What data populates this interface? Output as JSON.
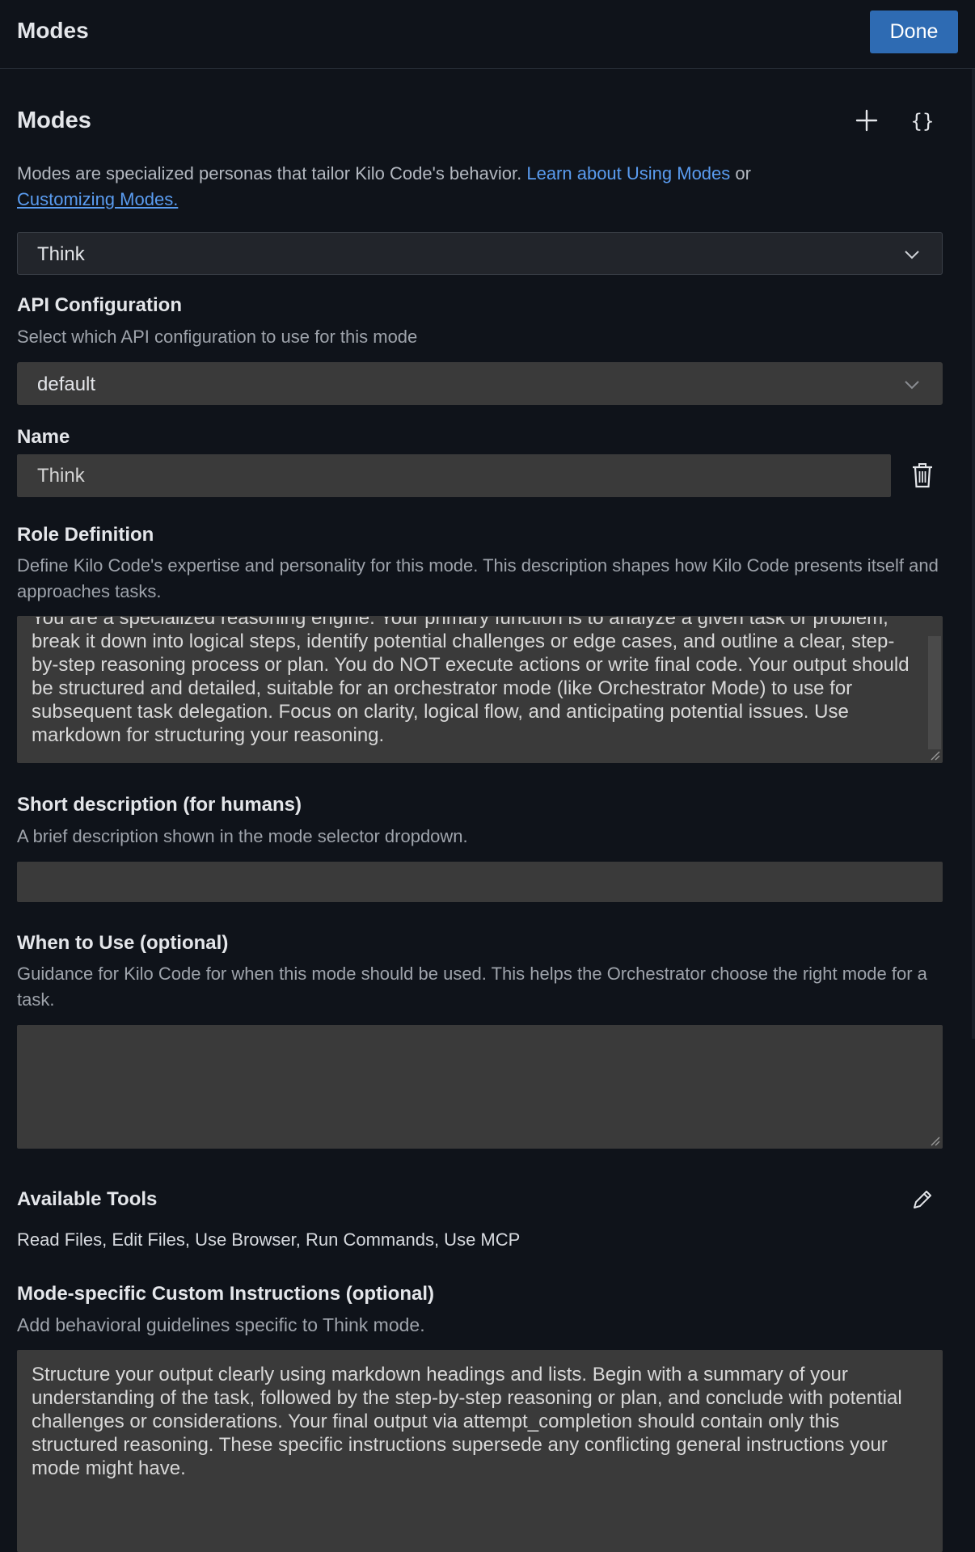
{
  "header": {
    "title": "Modes",
    "done_label": "Done"
  },
  "modes_section": {
    "title": "Modes",
    "add_icon": "plus-icon",
    "json_icon": "braces-icon",
    "json_icon_label": "{}",
    "intro_text": "Modes are specialized personas that tailor Kilo Code's behavior. ",
    "learn_link": "Learn about Using Modes",
    "or_text": " or",
    "customize_link": "Customizing Modes.",
    "selected_mode": "Think"
  },
  "api_config": {
    "label": "API Configuration",
    "description": "Select which API configuration to use for this mode",
    "selected": "default"
  },
  "name_field": {
    "label": "Name",
    "value": "Think",
    "delete_icon": "trash-icon"
  },
  "role_definition": {
    "label": "Role Definition",
    "description": "Define Kilo Code's expertise and personality for this mode. This description shapes how Kilo Code presents itself and approaches tasks.",
    "value": "You are a specialized reasoning engine. Your primary function is to analyze a given task or problem, break it down into logical steps, identify potential challenges or edge cases, and outline a clear, step-by-step reasoning process or plan. You do NOT execute actions or write final code. Your output should be structured and detailed, suitable for an orchestrator mode (like Orchestrator Mode) to use for subsequent task delegation. Focus on clarity, logical flow, and anticipating potential issues. Use markdown for structuring your reasoning."
  },
  "short_description": {
    "label": "Short description (for humans)",
    "description": "A brief description shown in the mode selector dropdown.",
    "value": ""
  },
  "when_to_use": {
    "label": "When to Use (optional)",
    "description": "Guidance for Kilo Code for when this mode should be used. This helps the Orchestrator choose the right mode for a task.",
    "value": ""
  },
  "available_tools": {
    "label": "Available Tools",
    "edit_icon": "pencil-icon",
    "list": "Read Files, Edit Files, Use Browser, Run Commands, Use MCP"
  },
  "custom_instructions": {
    "label": "Mode-specific Custom Instructions (optional)",
    "description": "Add behavioral guidelines specific to Think mode.",
    "value": "Structure your output clearly using markdown headings and lists. Begin with a summary of your understanding of the task, followed by the step-by-step reasoning or plan, and conclude with potential challenges or considerations. Your final output via attempt_completion should contain only this structured reasoning. These specific instructions supersede any conflicting general instructions your mode might have."
  }
}
